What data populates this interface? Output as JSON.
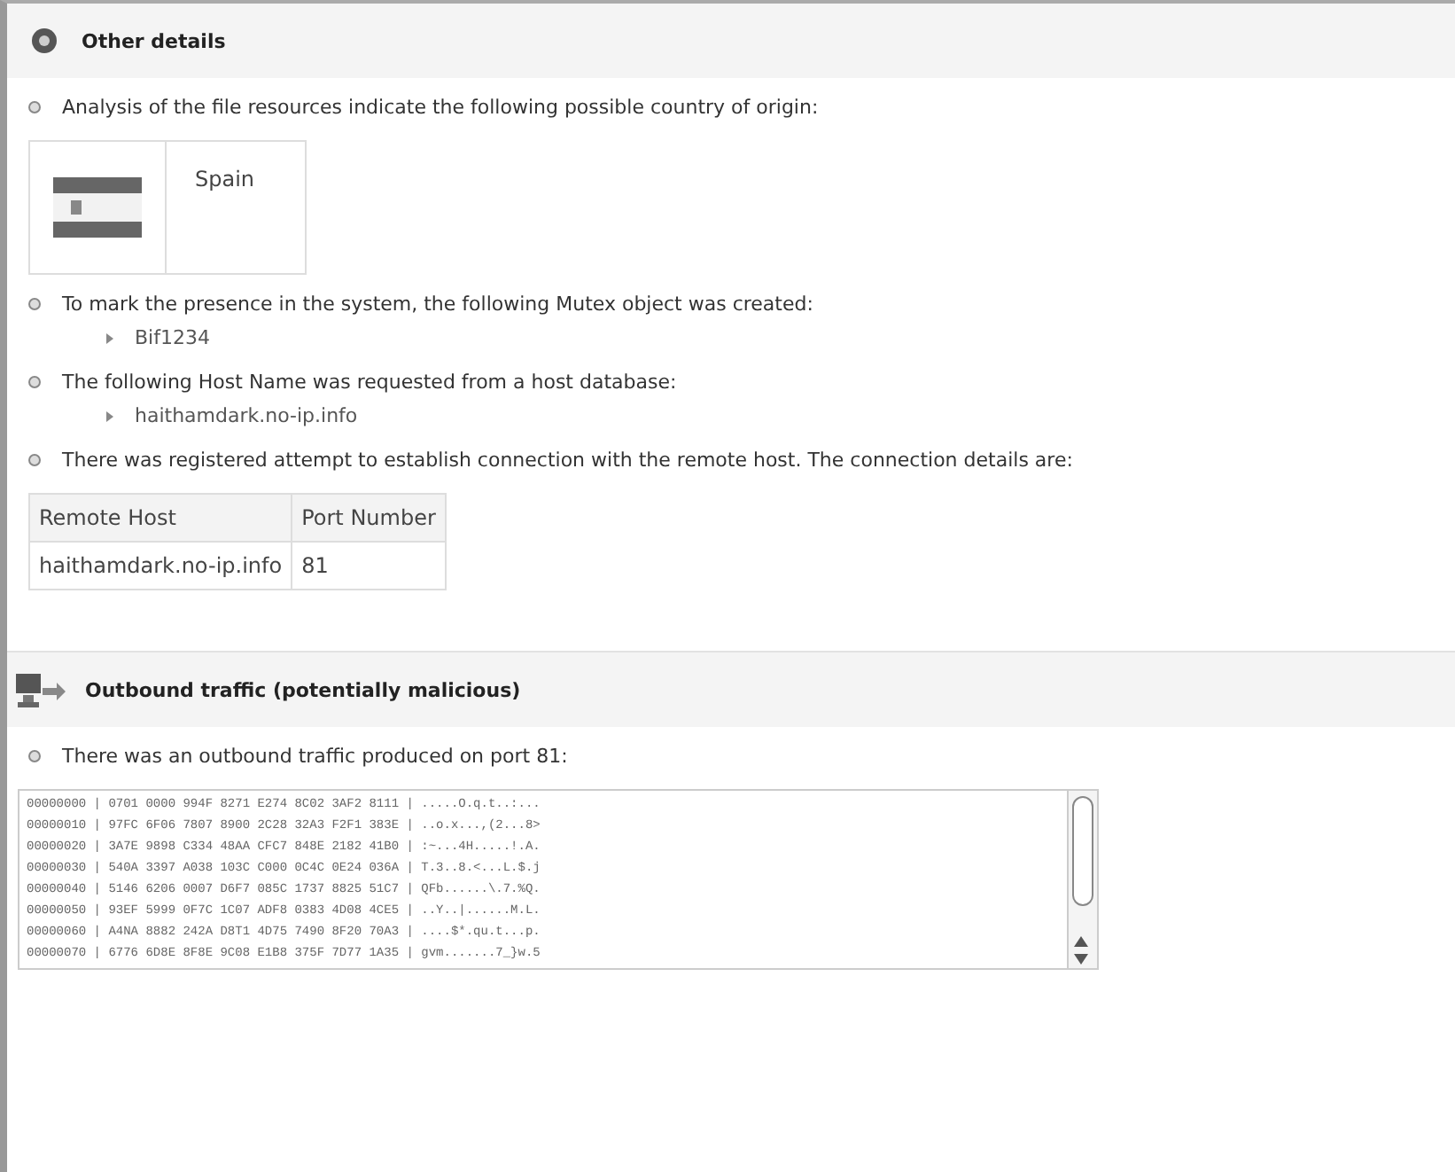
{
  "sections": [
    {
      "kind": "details",
      "title": "Other details",
      "items": [
        {
          "kind": "country",
          "text": "Analysis of the file resources indicate the following possible country of origin:",
          "country": "Spain"
        },
        {
          "kind": "list",
          "text": "To mark the presence in the system, the following Mutex object was created:",
          "values": [
            "Bif1234"
          ]
        },
        {
          "kind": "list",
          "text": "The following Host Name was requested from a host database:",
          "values": [
            "haithamdark.no-ip.info"
          ]
        },
        {
          "kind": "table",
          "text": "There was registered attempt to establish connection with the remote host. The connection details are:",
          "columns": [
            "Remote Host",
            "Port Number"
          ],
          "rows": [
            [
              "haithamdark.no-ip.info",
              "81"
            ]
          ]
        }
      ]
    },
    {
      "kind": "traffic",
      "title": "Outbound traffic (potentially malicious)",
      "items": [
        {
          "kind": "hexdump",
          "text": "There was an outbound traffic produced on port 81:",
          "lines": [
            "00000000 | 0701 0000 994F 8271 E274 8C02 3AF2 8111 | .....O.q.t..:...",
            "00000010 | 97FC 6F06 7807 8900 2C28 32A3 F2F1 383E | ..o.x...,(2...8>",
            "00000020 | 3A7E 9898 C334 48AA CFC7 848E 2182 41B0 | :~...4H.....!.A.",
            "00000030 | 540A 3397 A038 103C C000 0C4C 0E24 036A | T.3..8.<...L.$.j",
            "00000040 | 5146 6206 0007 D6F7 085C 1737 8825 51C7 | QFb......\\.7.%Q.",
            "00000050 | 93EF 5999 0F7C 1C07 ADF8 0383 4D08 4CE5 | ..Y..|......M.L.",
            "00000060 | A4NA 8882 242A D8T1 4D75 7490 8F20 70A3 | ....$*.qu.t...p.",
            "00000070 | 6776 6D8E 8F8E 9C08 E1B8 375F 7D77 1A35 | gvm.......7_}w.5"
          ]
        }
      ]
    }
  ]
}
